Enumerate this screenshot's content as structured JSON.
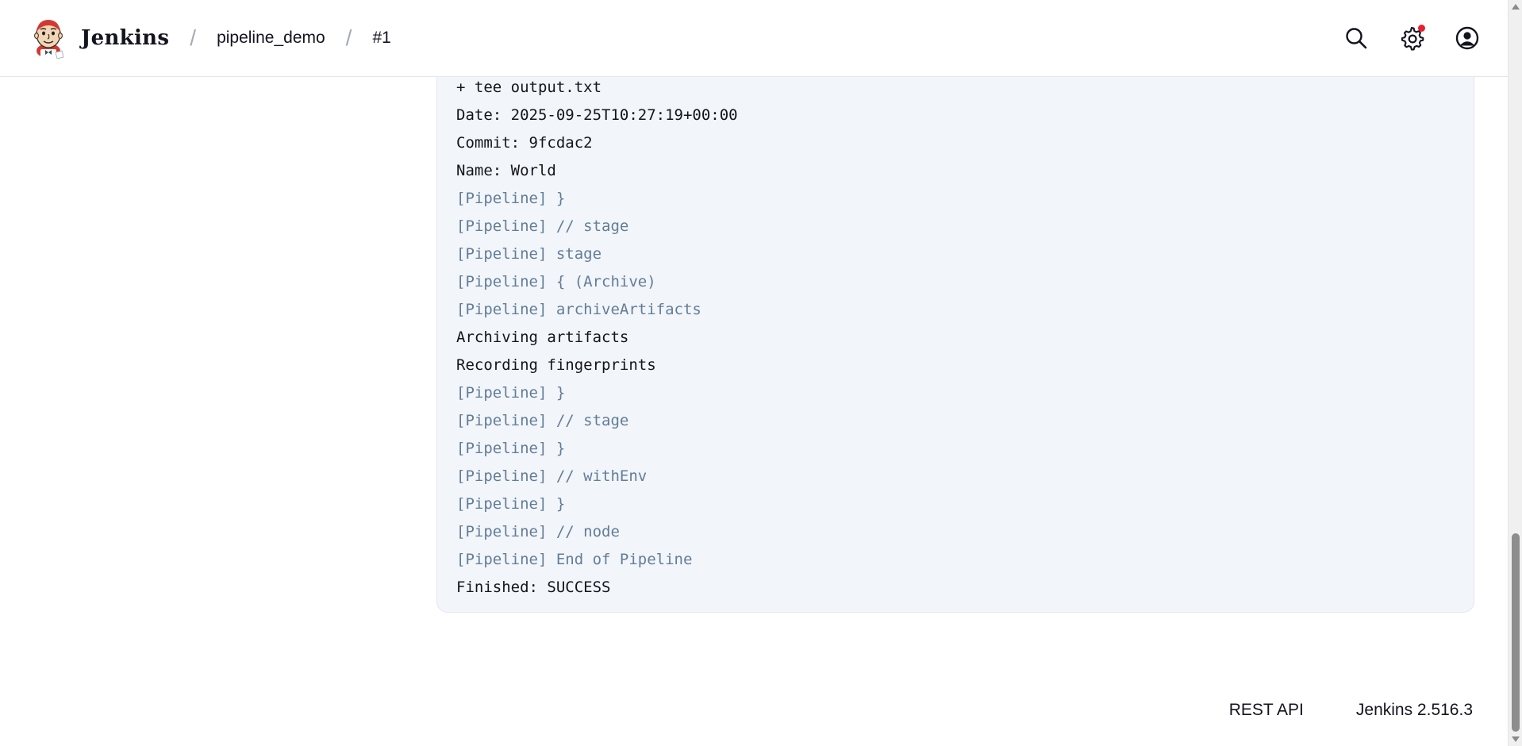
{
  "header": {
    "brand_name": "Jenkins",
    "breadcrumbs": [
      {
        "label": "pipeline_demo"
      },
      {
        "label": "#1"
      }
    ],
    "separator": "/",
    "icons": {
      "logo": "jenkins-logo",
      "search": "search-icon",
      "settings": "gear-icon",
      "account": "user-circle-icon"
    },
    "notification_color": "#e6202f"
  },
  "console": {
    "lines": [
      {
        "text": "+ tee output.txt",
        "type": "plain"
      },
      {
        "text": "Date: 2025-09-25T10:27:19+00:00",
        "type": "plain"
      },
      {
        "text": "Commit: 9fcdac2",
        "type": "plain"
      },
      {
        "text": "Name: World",
        "type": "plain"
      },
      {
        "text": "[Pipeline] }",
        "type": "pipeline"
      },
      {
        "text": "[Pipeline] // stage",
        "type": "pipeline"
      },
      {
        "text": "[Pipeline] stage",
        "type": "pipeline"
      },
      {
        "text": "[Pipeline] { (Archive)",
        "type": "pipeline"
      },
      {
        "text": "[Pipeline] archiveArtifacts",
        "type": "pipeline"
      },
      {
        "text": "Archiving artifacts",
        "type": "plain"
      },
      {
        "text": "Recording fingerprints",
        "type": "plain"
      },
      {
        "text": "[Pipeline] }",
        "type": "pipeline"
      },
      {
        "text": "[Pipeline] // stage",
        "type": "pipeline"
      },
      {
        "text": "[Pipeline] }",
        "type": "pipeline"
      },
      {
        "text": "[Pipeline] // withEnv",
        "type": "pipeline"
      },
      {
        "text": "[Pipeline] }",
        "type": "pipeline"
      },
      {
        "text": "[Pipeline] // node",
        "type": "pipeline"
      },
      {
        "text": "[Pipeline] End of Pipeline",
        "type": "pipeline"
      },
      {
        "text": "Finished: SUCCESS",
        "type": "plain"
      }
    ],
    "colors": {
      "pipeline": "#627d98",
      "plain": "#14141f",
      "background": "#f2f5f9"
    }
  },
  "footer": {
    "rest_api": "REST API",
    "version": "Jenkins 2.516.3"
  }
}
